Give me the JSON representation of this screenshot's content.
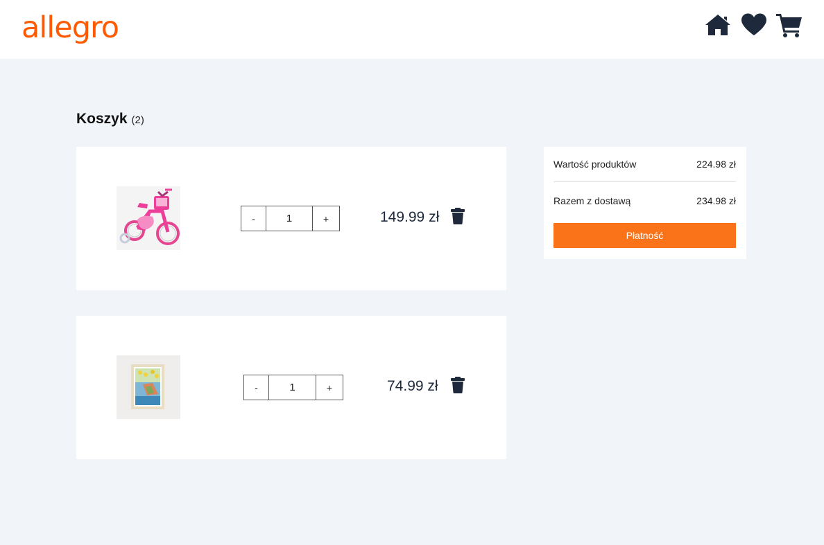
{
  "header": {
    "logo_text": "allegro",
    "icons": [
      "home-icon",
      "heart-icon",
      "cart-icon"
    ],
    "accent_color": "#ff5a00",
    "icon_color": "#1e2a3c"
  },
  "cart": {
    "title": "Koszyk",
    "count": "(2)",
    "items": [
      {
        "image": "pink-bicycle",
        "decrement": "-",
        "quantity": "1",
        "increment": "+",
        "price": "149.99 zł",
        "delete_icon": "trash-icon"
      },
      {
        "image": "framed-poster",
        "decrement": "-",
        "quantity": "1",
        "increment": "+",
        "price": "74.99 zł",
        "delete_icon": "trash-icon"
      }
    ]
  },
  "summary": {
    "products_label": "Wartość produktów",
    "products_value": "224.98 zł",
    "total_label": "Razem z dostawą",
    "total_value": "234.98 zł",
    "pay_button": "Płatność",
    "pay_color": "#fa7318"
  }
}
